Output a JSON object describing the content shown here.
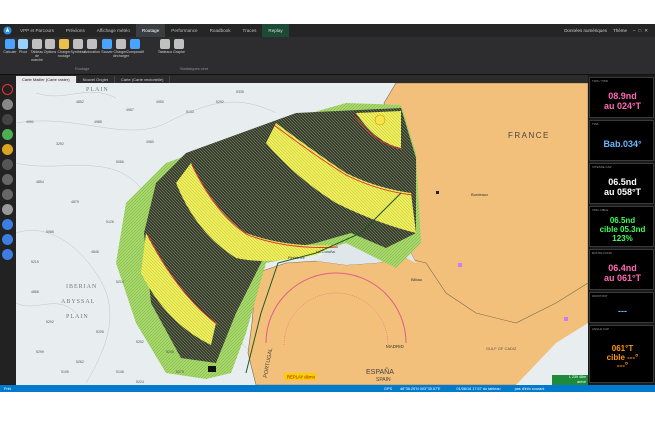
{
  "menu": {
    "tabs": [
      "VPP et Parcours",
      "Préviions",
      "Affichage météo",
      "Routage",
      "Performance",
      "Roadbook",
      "Traces",
      "Replay"
    ],
    "right": [
      "Données numériques",
      "Thème"
    ]
  },
  "ribbon": {
    "buttons": [
      {
        "label": "Calculer",
        "icon": "calculate-icon",
        "color": "#4aa3ff"
      },
      {
        "label": "Pivot",
        "icon": "pivot-icon",
        "color": "#9ad0ff"
      },
      {
        "label": "Tableau de marche",
        "icon": "table-icon",
        "color": "#c0c0c0"
      },
      {
        "label": "Options",
        "icon": "options-icon",
        "color": "#c0c0c0"
      },
      {
        "label": "Charger routage",
        "icon": "load-icon",
        "color": "#e8c04a"
      },
      {
        "label": "Synthèse",
        "icon": "summary-icon",
        "color": "#c0c0c0"
      },
      {
        "label": "Animation",
        "icon": "animation-icon",
        "color": "#c0c0c0"
      },
      {
        "label": "Sauver",
        "icon": "save-icon",
        "color": "#4aa3ff"
      },
      {
        "label": "Charger / décharger",
        "icon": "load-unload-icon",
        "color": "#c0c0c0"
      },
      {
        "label": "Comparatif",
        "icon": "compare-icon",
        "color": "#4aa3ff"
      },
      {
        "label": "Tableaux",
        "icon": "tables-icon",
        "color": "#c0c0c0"
      },
      {
        "label": "Graphe",
        "icon": "graph-icon",
        "color": "#c0c0c0"
      }
    ],
    "group_labels": [
      "Routage",
      "Statistiques vent"
    ]
  },
  "doc_tabs": [
    "Carte Mailler (Carte raster)",
    "Nouvel Onglet",
    "Carte (Carte vectorielle)"
  ],
  "map_labels": {
    "france": "FRANCE",
    "espana": "ESPAÑA",
    "spain": "SPAIN",
    "portugal": "PORTUGAL",
    "madrid": "MADRID",
    "bordeaux": "Bordeaux",
    "bilbao": "Bilbao",
    "la_coruna": "La Coruña",
    "finisterre": "Finisterre",
    "iberian": "IBERIAN",
    "abyssal": "ABYSSAL",
    "plain_top": "PLAIN",
    "plain_bottom": "PLAIN",
    "gulf_cadiz": "GULF OF CADIZ",
    "replay": "REPLAY démo"
  },
  "depths": [
    "3292",
    "4985",
    "4957",
    "4852",
    "4854",
    "4879",
    "5126",
    "5086",
    "4846",
    "5215",
    "5214",
    "5292",
    "5205",
    "5252",
    "5206",
    "5299",
    "5262",
    "5146",
    "4950",
    "5133",
    "5292",
    "5335",
    "4991",
    "4980",
    "5086",
    "4868",
    "5195",
    "5224",
    "5275",
    "5336"
  ],
  "map_badge": {
    "line1": "L 239 48m",
    "line2": "arrivé"
  },
  "panels": [
    {
      "label": "TWS / TWD",
      "lines": [
        "08.9nd",
        "au 024°T"
      ],
      "color": "#ff69b4"
    },
    {
      "label": "TWA",
      "lines": [
        "Bab.034°"
      ],
      "color": "#6ab8ff"
    },
    {
      "label": "VITESSE CAP",
      "lines": [
        "06.5nd",
        "au 058°T"
      ],
      "color": "#ffffff"
    },
    {
      "label": "VMG CIBLE",
      "lines": [
        "06.5nd",
        "cible 05.3nd",
        "123%"
      ],
      "color": "#3cff5a"
    },
    {
      "label": "ROUTE FOND",
      "lines": [
        "06.4nd",
        "au 061°T"
      ],
      "color": "#ff69b4"
    },
    {
      "label": "WAYPOINT",
      "lines": [
        "---"
      ],
      "color": "#6ab8ff"
    },
    {
      "label": "ANGLE CAP",
      "lines": [
        "061°T",
        "cible ---°",
        "---°"
      ],
      "color": "#ff9a00"
    }
  ],
  "status": {
    "left": "Prêt",
    "gps": "GPS",
    "pos": "46°36.26'N 003°35.57'E",
    "mid": "01/08/16 17:57 du tableau",
    "right": "pas d'info courant"
  }
}
